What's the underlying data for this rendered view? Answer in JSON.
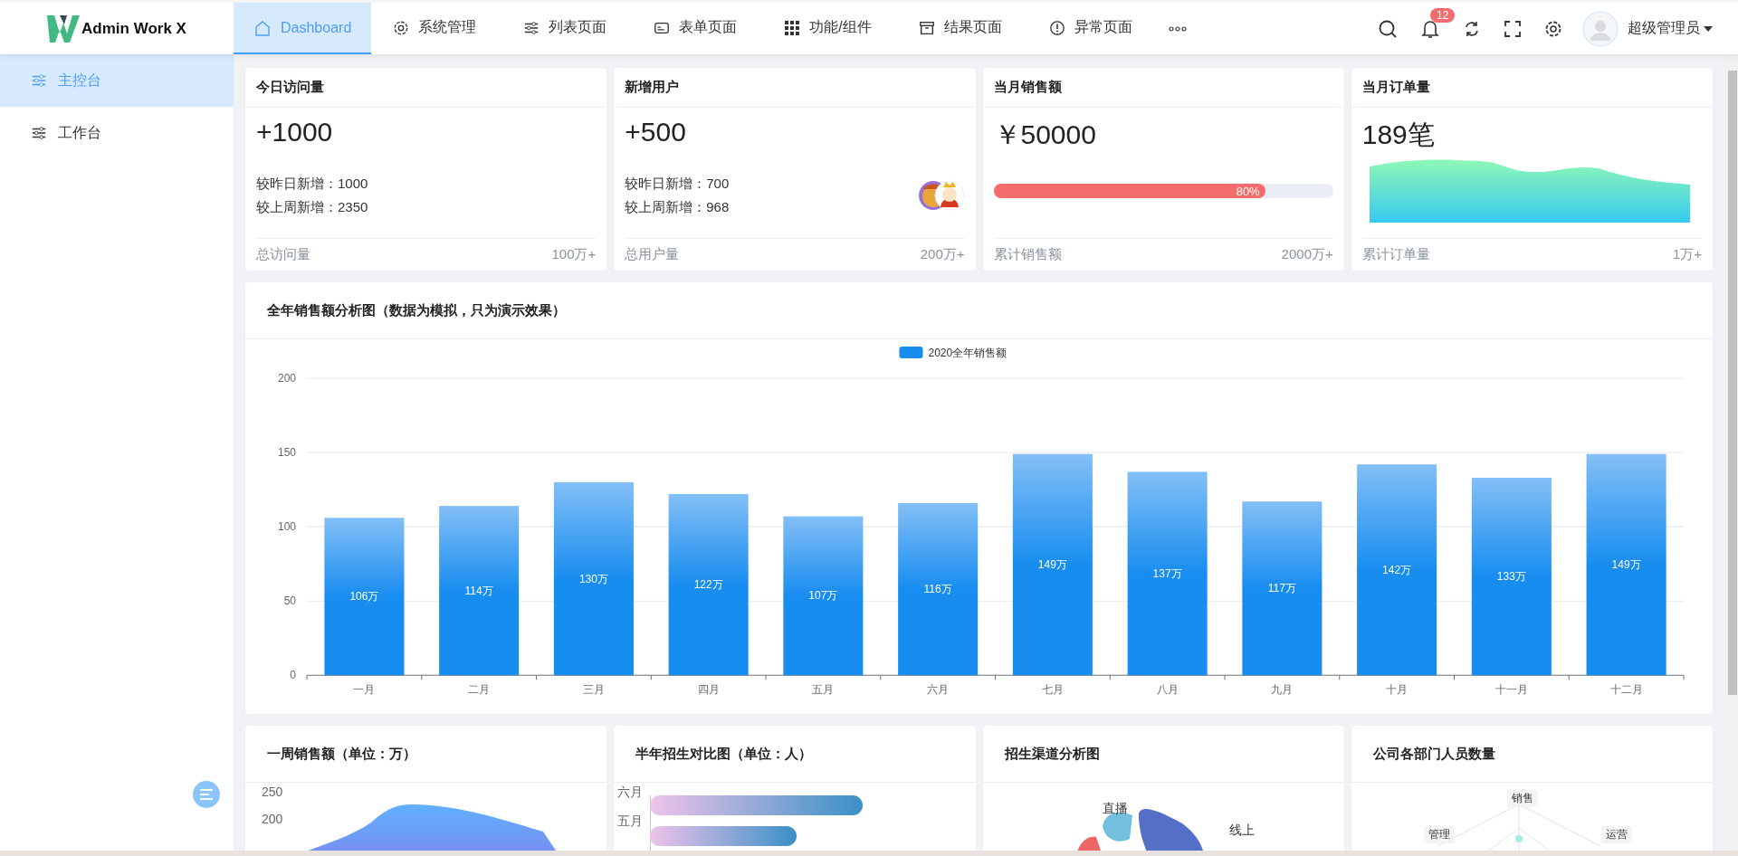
{
  "header": {
    "logo": "Admin Work X",
    "nav": [
      {
        "label": "Dashboard",
        "selected": true
      },
      {
        "label": "系统管理",
        "selected": false
      },
      {
        "label": "列表页面",
        "selected": false
      },
      {
        "label": "表单页面",
        "selected": false
      },
      {
        "label": "功能/组件",
        "selected": false
      },
      {
        "label": "结果页面",
        "selected": false
      },
      {
        "label": "异常页面",
        "selected": false
      }
    ],
    "notification_badge": "12",
    "user_name": "超级管理员"
  },
  "sidebar": {
    "items": [
      {
        "label": "主控台",
        "selected": true
      },
      {
        "label": "工作台",
        "selected": false
      }
    ]
  },
  "stat_cards": [
    {
      "title": "今日访问量",
      "value": "+1000",
      "kind": "lines",
      "lines": [
        "较昨日新增：1000",
        "较上周新增：2350"
      ],
      "footer_label": "总访问量",
      "footer_value": "100万+"
    },
    {
      "title": "新增用户",
      "value": "+500",
      "kind": "avatars",
      "lines": [
        "较昨日新增：700",
        "较上周新增：968"
      ],
      "footer_label": "总用户量",
      "footer_value": "200万+"
    },
    {
      "title": "当月销售额",
      "value": "￥50000",
      "kind": "progress",
      "level": 0.8,
      "progress_label": "80%",
      "footer_label": "累计销售额",
      "footer_value": "2000万+"
    },
    {
      "title": "当月订单量",
      "value": "189笔",
      "kind": "area",
      "footer_label": "累计订单量",
      "footer_value": "1万+"
    }
  ],
  "sales_chart": {
    "title": "全年销售额分析图（数据为模拟，只为演示效果）",
    "chart_data": {
      "type": "bar",
      "categories": [
        "一月",
        "二月",
        "三月",
        "四月",
        "五月",
        "六月",
        "七月",
        "八月",
        "九月",
        "十月",
        "十一月",
        "十二月"
      ],
      "series": [
        {
          "name": "2020全年销售额",
          "color": "#188df0",
          "values": [
            106,
            114,
            130,
            122,
            107,
            116,
            149,
            137,
            117,
            142,
            133,
            149
          ]
        }
      ],
      "ylim": [
        0,
        200
      ],
      "yticks": [
        0,
        50,
        100,
        150,
        200
      ],
      "grid": true,
      "value_labels": [
        "106万",
        "114万",
        "130万",
        "122万",
        "107万",
        "116万",
        "149万",
        "137万",
        "117万",
        "142万",
        "133万",
        "149万"
      ]
    }
  },
  "bottom_cards": [
    {
      "title": "一周销售额（单位：万）",
      "kind": "area",
      "labels": [
        "250",
        "200"
      ]
    },
    {
      "title": "半年招生对比图（单位：人）",
      "kind": "bars",
      "labels": [
        "六月",
        "五月"
      ]
    },
    {
      "title": "招生渠道分析图",
      "kind": "pie",
      "labels": [
        "直播",
        "线上"
      ]
    },
    {
      "title": "公司各部门人员数量",
      "kind": "radar",
      "labels": [
        "销售",
        "管理",
        "运营"
      ]
    }
  ]
}
